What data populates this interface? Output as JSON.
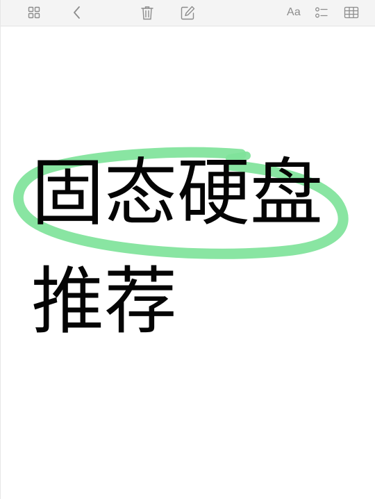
{
  "toolbar": {
    "items": [
      {
        "name": "grid-view-icon",
        "type": "icon"
      },
      {
        "name": "back-chevron-icon",
        "type": "icon"
      },
      {
        "name": "trash-icon",
        "type": "icon"
      },
      {
        "name": "compose-icon",
        "type": "icon"
      },
      {
        "name": "format-text",
        "type": "text",
        "label": "Aa"
      },
      {
        "name": "checklist-icon",
        "type": "icon"
      },
      {
        "name": "table-icon",
        "type": "icon"
      }
    ],
    "icon_color": "#8c8c8c",
    "background": "#f4f4f4"
  },
  "note": {
    "line1": "固态硬盘",
    "line2": "推荐",
    "text_color": "#050505",
    "highlight_color": "#7fe39a",
    "highlight_target": "line1"
  }
}
